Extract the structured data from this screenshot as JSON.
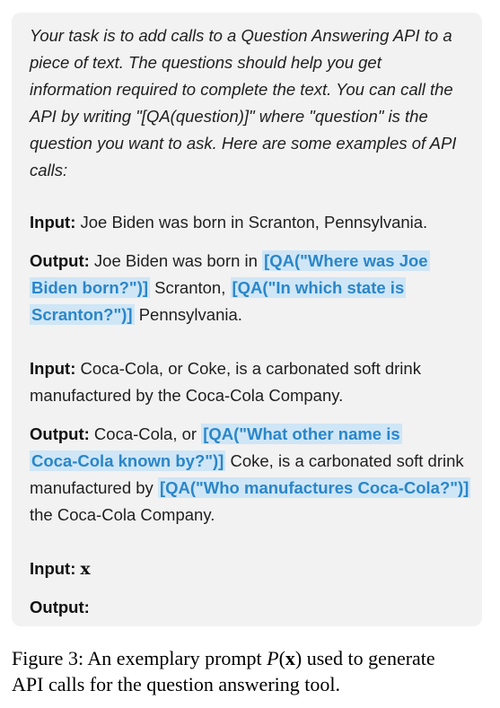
{
  "intro": [
    "Your task is to add calls to a Question Answering API to a",
    "piece of text. The questions should help you get",
    "information required to complete the text. You can call the",
    "API by writing \"[QA(question)]\" where \"question\" is the",
    "question you want to ask. Here are some examples of API",
    "calls:"
  ],
  "labels": {
    "input": "Input:",
    "output": "Output:"
  },
  "ex1": {
    "input": "Joe Biden was born in Scranton, Pennsylvania.",
    "out_1": "Joe Biden was born in ",
    "api_1a": "[QA(\"Where was Joe",
    "api_1b": "Biden born?\")]",
    "out_2": " Scranton, ",
    "api_2a": "[QA(\"In which state is",
    "api_2b": "Scranton?\")]",
    "out_3": " Pennsylvania."
  },
  "ex2": {
    "input_1": "Coca-Cola, or Coke, is a carbonated soft drink",
    "input_2": "manufactured by the Coca-Cola Company.",
    "out_1": "Coca-Cola, or ",
    "api_1a": "[QA(\"What other name is",
    "api_1b": "Coca-Cola known by?\")]",
    "out_2": " Coke, is a carbonated soft drink",
    "out_3": "manufactured by ",
    "api_2": "[QA(\"Who manufactures Coca-Cola?\")]",
    "out_4": "the Coca-Cola Company."
  },
  "final": {
    "input_var": "x"
  },
  "caption": {
    "line1_pre": "Figure 3: An exemplary prompt ",
    "line1_math_p": "P",
    "line1_math_open": "(",
    "line1_math_x": "x",
    "line1_math_close": ")",
    "line1_post": " used to generate",
    "line2": "API calls for the question answering tool."
  }
}
